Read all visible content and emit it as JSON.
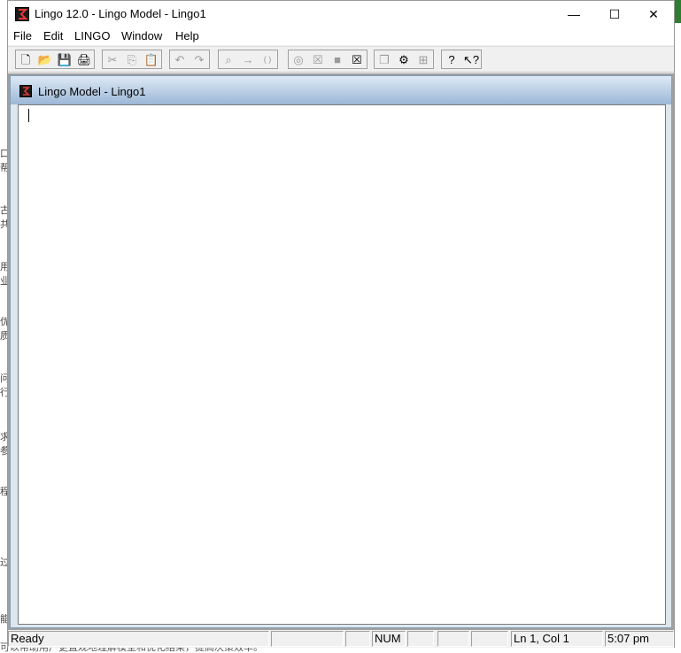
{
  "window": {
    "title": "Lingo 12.0 - Lingo Model - Lingo1",
    "minimize_icon": "—",
    "maximize_icon": "☐",
    "close_icon": "✕"
  },
  "menu": [
    "File",
    "Edit",
    "LINGO",
    "Window",
    "Help"
  ],
  "toolbar": {
    "groups": [
      [
        {
          "name": "new-icon",
          "glyph": "🗋",
          "enabled": true
        },
        {
          "name": "open-icon",
          "glyph": "📂",
          "enabled": true
        },
        {
          "name": "save-icon",
          "glyph": "💾",
          "enabled": true
        },
        {
          "name": "print-icon",
          "glyph": "🖨",
          "enabled": true
        }
      ],
      [
        {
          "name": "cut-icon",
          "glyph": "✂",
          "enabled": false
        },
        {
          "name": "copy-icon",
          "glyph": "⎘",
          "enabled": false
        },
        {
          "name": "paste-icon",
          "glyph": "📋",
          "enabled": true
        }
      ],
      [
        {
          "name": "undo-icon",
          "glyph": "↶",
          "enabled": false
        },
        {
          "name": "redo-icon",
          "glyph": "↷",
          "enabled": false
        }
      ],
      [
        {
          "name": "find-icon",
          "glyph": "⌕",
          "enabled": false
        },
        {
          "name": "goto-line-icon",
          "glyph": "→",
          "enabled": false
        },
        {
          "name": "match-parenthesis-icon",
          "glyph": "( )",
          "enabled": false
        }
      ],
      [
        {
          "name": "solve-icon",
          "glyph": "◎",
          "enabled": false
        },
        {
          "name": "solution-icon",
          "glyph": "☒",
          "enabled": false
        },
        {
          "name": "stop-icon",
          "glyph": "■",
          "enabled": false
        },
        {
          "name": "close-all-icon",
          "glyph": "☒",
          "enabled": true
        }
      ],
      [
        {
          "name": "send-to-back-icon",
          "glyph": "❐",
          "enabled": false
        },
        {
          "name": "options-icon",
          "glyph": "⚙",
          "enabled": true
        },
        {
          "name": "tile-icon",
          "glyph": "⊞",
          "enabled": false
        }
      ],
      [
        {
          "name": "help-icon",
          "glyph": "?",
          "enabled": true
        },
        {
          "name": "context-help-icon",
          "glyph": "↖?",
          "enabled": true
        }
      ]
    ]
  },
  "child_window": {
    "title": "Lingo Model - Lingo1"
  },
  "status": {
    "ready": "Ready",
    "num": "NUM",
    "position": "Ln 1, Col 1",
    "time": "5:07 pm"
  },
  "background": {
    "left_glyphs": [
      "口",
      "帮",
      "古",
      "共",
      "用",
      "业",
      "优",
      "质",
      "问",
      "行",
      "求",
      "参",
      "程",
      "过",
      "能"
    ],
    "bottom_text": "可以帮助用户更直观地理解模型和优化结果，提高决策效率。"
  }
}
